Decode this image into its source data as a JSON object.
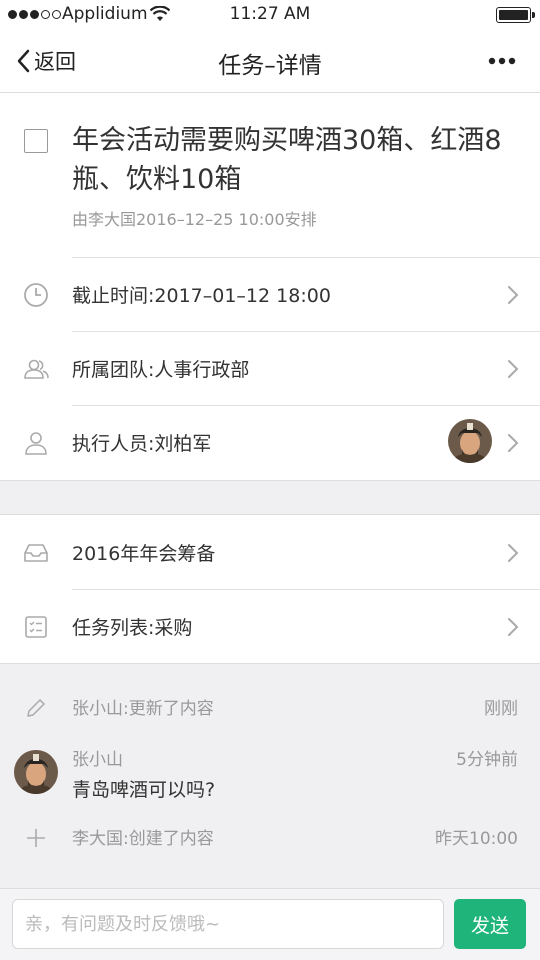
{
  "status_bar": {
    "carrier": "Applidium",
    "time": "11:27 AM",
    "signal_bars": 3
  },
  "nav": {
    "back_label": "返回",
    "title": "任务–详情"
  },
  "task": {
    "title": "年会活动需要购买啤酒30箱、红酒8瓶、饮料10箱",
    "meta": "由李大国2016–12–25 10:00安排",
    "checked": false
  },
  "details": {
    "deadline": "截止时间:2017–01–12 18:00",
    "team": "所属团队:人事行政部",
    "assignee": "执行人员:刘柏军"
  },
  "project": {
    "name": "2016年年会筹备",
    "task_list": "任务列表:采购"
  },
  "activity": {
    "updated_text": "张小山:更新了内容",
    "updated_time": "刚刚",
    "comment_author": "张小山",
    "comment_time": "5分钟前",
    "comment_body": "青岛啤酒可以吗?",
    "created_text": "李大国:创建了内容",
    "created_time": "昨天10:00"
  },
  "input": {
    "placeholder": "亲，有问题及时反馈哦~",
    "send_label": "发送"
  },
  "colors": {
    "accent": "#1fb57a",
    "muted": "#999999",
    "section_bg": "#f0f0f3"
  }
}
